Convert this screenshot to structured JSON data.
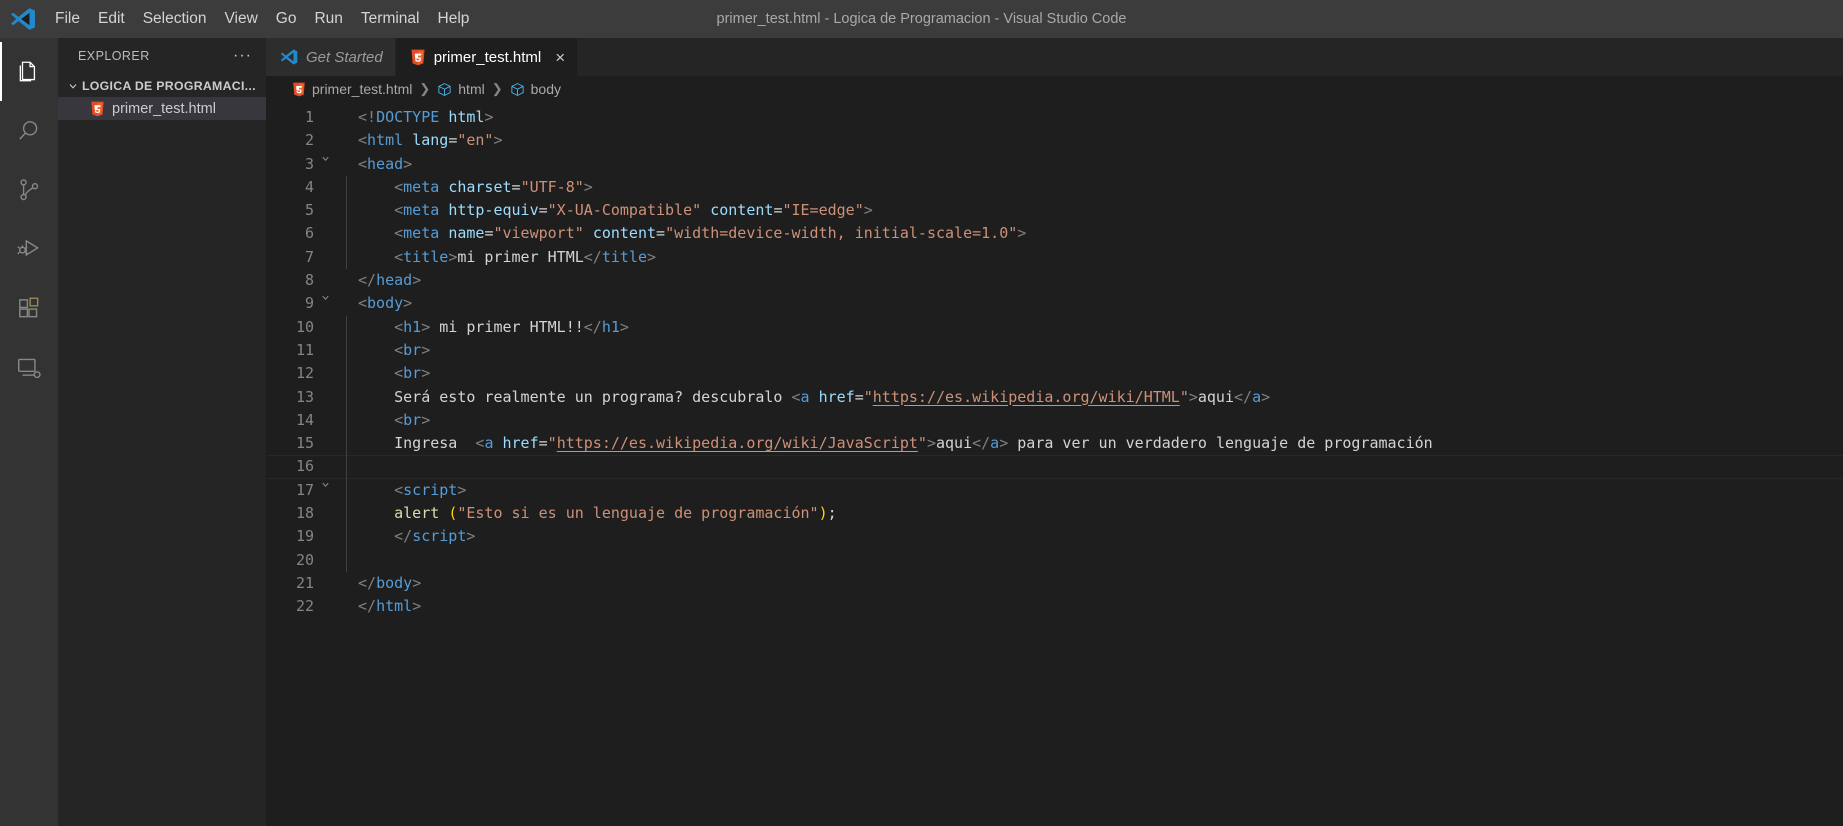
{
  "window": {
    "title": "primer_test.html - Logica de Programacion - Visual Studio Code",
    "logo_icon": "vscode-logo-icon"
  },
  "menubar": {
    "items": [
      {
        "label": "File"
      },
      {
        "label": "Edit"
      },
      {
        "label": "Selection"
      },
      {
        "label": "View"
      },
      {
        "label": "Go"
      },
      {
        "label": "Run"
      },
      {
        "label": "Terminal"
      },
      {
        "label": "Help"
      }
    ]
  },
  "activitybar": {
    "items": [
      {
        "icon": "files-explorer-icon",
        "name": "activitybar-explorer",
        "active": true
      },
      {
        "icon": "search-icon",
        "name": "activitybar-search",
        "active": false
      },
      {
        "icon": "source-control-icon",
        "name": "activitybar-source-control",
        "active": false
      },
      {
        "icon": "run-and-debug-icon",
        "name": "activitybar-run-debug",
        "active": false
      },
      {
        "icon": "extensions-icon",
        "name": "activitybar-extensions",
        "active": false
      },
      {
        "icon": "remote-explorer-icon",
        "name": "activitybar-remote-explorer",
        "active": false
      }
    ]
  },
  "sidebar": {
    "title": "EXPLORER",
    "actions_label": "···",
    "folder": {
      "name": "LOGICA DE PROGRAMACI...",
      "expanded": true,
      "twisty_icon": "chevron-down-icon"
    },
    "files": [
      {
        "name": "primer_test.html",
        "icon": "html5-file-icon",
        "selected": true
      }
    ]
  },
  "tabs": [
    {
      "label": "Get Started",
      "icon": "vscode-logo-icon",
      "active": false,
      "preview": true,
      "closeable": false
    },
    {
      "label": "primer_test.html",
      "icon": "html5-file-icon",
      "active": true,
      "preview": false,
      "closeable": true,
      "close_label": "×"
    }
  ],
  "breadcrumbs": {
    "separator": "❯",
    "items": [
      {
        "label": "primer_test.html",
        "icon": "html5-file-icon"
      },
      {
        "label": "html",
        "icon": "symbol-class-icon"
      },
      {
        "label": "body",
        "icon": "symbol-class-icon"
      }
    ]
  },
  "editor": {
    "colors": {
      "background": "#1e1e1e",
      "tag": "#569cd6",
      "attribute": "#9cdcfe",
      "string": "#ce9178",
      "text": "#d4d4d4",
      "function": "#dcdcaa",
      "paren": "#ffd700",
      "linenumber": "#858585"
    },
    "lines": [
      {
        "n": 1,
        "fold": "",
        "guide": false,
        "cursor": false,
        "tokens": [
          {
            "c": "punct",
            "t": "<!"
          },
          {
            "c": "tag",
            "t": "DOCTYPE"
          },
          {
            "c": "text",
            "t": " "
          },
          {
            "c": "attr",
            "t": "html"
          },
          {
            "c": "punct",
            "t": ">"
          }
        ]
      },
      {
        "n": 2,
        "fold": "",
        "guide": false,
        "cursor": false,
        "tokens": [
          {
            "c": "punct",
            "t": "<"
          },
          {
            "c": "tag",
            "t": "html"
          },
          {
            "c": "text",
            "t": " "
          },
          {
            "c": "attr",
            "t": "lang"
          },
          {
            "c": "eq",
            "t": "="
          },
          {
            "c": "str",
            "t": "\"en\""
          },
          {
            "c": "punct",
            "t": ">"
          }
        ]
      },
      {
        "n": 3,
        "fold": "chevron-down-icon",
        "guide": false,
        "cursor": false,
        "tokens": [
          {
            "c": "punct",
            "t": "<"
          },
          {
            "c": "tag",
            "t": "head"
          },
          {
            "c": "punct",
            "t": ">"
          }
        ]
      },
      {
        "n": 4,
        "fold": "",
        "guide": true,
        "cursor": false,
        "tokens": [
          {
            "c": "text",
            "t": "    "
          },
          {
            "c": "punct",
            "t": "<"
          },
          {
            "c": "tag",
            "t": "meta"
          },
          {
            "c": "text",
            "t": " "
          },
          {
            "c": "attr",
            "t": "charset"
          },
          {
            "c": "eq",
            "t": "="
          },
          {
            "c": "str",
            "t": "\"UTF-8\""
          },
          {
            "c": "punct",
            "t": ">"
          }
        ]
      },
      {
        "n": 5,
        "fold": "",
        "guide": true,
        "cursor": false,
        "tokens": [
          {
            "c": "text",
            "t": "    "
          },
          {
            "c": "punct",
            "t": "<"
          },
          {
            "c": "tag",
            "t": "meta"
          },
          {
            "c": "text",
            "t": " "
          },
          {
            "c": "attr",
            "t": "http-equiv"
          },
          {
            "c": "eq",
            "t": "="
          },
          {
            "c": "str",
            "t": "\"X-UA-Compatible\""
          },
          {
            "c": "text",
            "t": " "
          },
          {
            "c": "attr",
            "t": "content"
          },
          {
            "c": "eq",
            "t": "="
          },
          {
            "c": "str",
            "t": "\"IE=edge\""
          },
          {
            "c": "punct",
            "t": ">"
          }
        ]
      },
      {
        "n": 6,
        "fold": "",
        "guide": true,
        "cursor": false,
        "tokens": [
          {
            "c": "text",
            "t": "    "
          },
          {
            "c": "punct",
            "t": "<"
          },
          {
            "c": "tag",
            "t": "meta"
          },
          {
            "c": "text",
            "t": " "
          },
          {
            "c": "attr",
            "t": "name"
          },
          {
            "c": "eq",
            "t": "="
          },
          {
            "c": "str",
            "t": "\"viewport\""
          },
          {
            "c": "text",
            "t": " "
          },
          {
            "c": "attr",
            "t": "content"
          },
          {
            "c": "eq",
            "t": "="
          },
          {
            "c": "str",
            "t": "\"width=device-width, initial-scale=1.0\""
          },
          {
            "c": "punct",
            "t": ">"
          }
        ]
      },
      {
        "n": 7,
        "fold": "",
        "guide": true,
        "cursor": false,
        "tokens": [
          {
            "c": "text",
            "t": "    "
          },
          {
            "c": "punct",
            "t": "<"
          },
          {
            "c": "tag",
            "t": "title"
          },
          {
            "c": "punct",
            "t": ">"
          },
          {
            "c": "text",
            "t": "mi primer HTML"
          },
          {
            "c": "punct",
            "t": "</"
          },
          {
            "c": "tag",
            "t": "title"
          },
          {
            "c": "punct",
            "t": ">"
          }
        ]
      },
      {
        "n": 8,
        "fold": "",
        "guide": false,
        "cursor": false,
        "tokens": [
          {
            "c": "punct",
            "t": "</"
          },
          {
            "c": "tag",
            "t": "head"
          },
          {
            "c": "punct",
            "t": ">"
          }
        ]
      },
      {
        "n": 9,
        "fold": "chevron-down-icon",
        "guide": false,
        "cursor": false,
        "tokens": [
          {
            "c": "punct",
            "t": "<"
          },
          {
            "c": "tag",
            "t": "body"
          },
          {
            "c": "punct",
            "t": ">"
          }
        ]
      },
      {
        "n": 10,
        "fold": "",
        "guide": true,
        "cursor": false,
        "tokens": [
          {
            "c": "text",
            "t": "    "
          },
          {
            "c": "punct",
            "t": "<"
          },
          {
            "c": "tag",
            "t": "h1"
          },
          {
            "c": "punct",
            "t": ">"
          },
          {
            "c": "text",
            "t": " mi primer HTML!!"
          },
          {
            "c": "punct",
            "t": "</"
          },
          {
            "c": "tag",
            "t": "h1"
          },
          {
            "c": "punct",
            "t": ">"
          }
        ]
      },
      {
        "n": 11,
        "fold": "",
        "guide": true,
        "cursor": false,
        "tokens": [
          {
            "c": "text",
            "t": "    "
          },
          {
            "c": "punct",
            "t": "<"
          },
          {
            "c": "tag",
            "t": "br"
          },
          {
            "c": "punct",
            "t": ">"
          }
        ]
      },
      {
        "n": 12,
        "fold": "",
        "guide": true,
        "cursor": false,
        "tokens": [
          {
            "c": "text",
            "t": "    "
          },
          {
            "c": "punct",
            "t": "<"
          },
          {
            "c": "tag",
            "t": "br"
          },
          {
            "c": "punct",
            "t": ">"
          }
        ]
      },
      {
        "n": 13,
        "fold": "",
        "guide": true,
        "cursor": false,
        "tokens": [
          {
            "c": "text",
            "t": "    Será esto realmente un programa? descubralo "
          },
          {
            "c": "punct",
            "t": "<"
          },
          {
            "c": "tag",
            "t": "a"
          },
          {
            "c": "text",
            "t": " "
          },
          {
            "c": "attr",
            "t": "href"
          },
          {
            "c": "eq",
            "t": "="
          },
          {
            "c": "str",
            "t": "\""
          },
          {
            "c": "link",
            "t": "https://es.wikipedia.org/wiki/HTML"
          },
          {
            "c": "str",
            "t": "\""
          },
          {
            "c": "punct",
            "t": ">"
          },
          {
            "c": "text",
            "t": "aqui"
          },
          {
            "c": "punct",
            "t": "</"
          },
          {
            "c": "tag",
            "t": "a"
          },
          {
            "c": "punct",
            "t": ">"
          }
        ]
      },
      {
        "n": 14,
        "fold": "",
        "guide": true,
        "cursor": false,
        "tokens": [
          {
            "c": "text",
            "t": "    "
          },
          {
            "c": "punct",
            "t": "<"
          },
          {
            "c": "tag",
            "t": "br"
          },
          {
            "c": "punct",
            "t": ">"
          }
        ]
      },
      {
        "n": 15,
        "fold": "",
        "guide": true,
        "cursor": false,
        "tokens": [
          {
            "c": "text",
            "t": "    Ingresa  "
          },
          {
            "c": "punct",
            "t": "<"
          },
          {
            "c": "tag",
            "t": "a"
          },
          {
            "c": "text",
            "t": " "
          },
          {
            "c": "attr",
            "t": "href"
          },
          {
            "c": "eq",
            "t": "="
          },
          {
            "c": "str",
            "t": "\""
          },
          {
            "c": "link",
            "t": "https://es.wikipedia.org/wiki/JavaScript"
          },
          {
            "c": "str",
            "t": "\""
          },
          {
            "c": "punct",
            "t": ">"
          },
          {
            "c": "text",
            "t": "aqui"
          },
          {
            "c": "punct",
            "t": "</"
          },
          {
            "c": "tag",
            "t": "a"
          },
          {
            "c": "punct",
            "t": ">"
          },
          {
            "c": "text",
            "t": " para ver un verdadero lenguaje de programación"
          }
        ]
      },
      {
        "n": 16,
        "fold": "",
        "guide": true,
        "cursor": true,
        "tokens": []
      },
      {
        "n": 17,
        "fold": "chevron-down-icon",
        "guide": true,
        "cursor": false,
        "tokens": [
          {
            "c": "text",
            "t": "    "
          },
          {
            "c": "punct",
            "t": "<"
          },
          {
            "c": "tag",
            "t": "script"
          },
          {
            "c": "punct",
            "t": ">"
          }
        ]
      },
      {
        "n": 18,
        "fold": "",
        "guide": true,
        "cursor": false,
        "tokens": [
          {
            "c": "text",
            "t": "    "
          },
          {
            "c": "fn",
            "t": "alert"
          },
          {
            "c": "text",
            "t": " "
          },
          {
            "c": "paren",
            "t": "("
          },
          {
            "c": "str",
            "t": "\"Esto si es un lenguaje de programación\""
          },
          {
            "c": "paren",
            "t": ")"
          },
          {
            "c": "semi",
            "t": ";"
          }
        ]
      },
      {
        "n": 19,
        "fold": "",
        "guide": true,
        "cursor": false,
        "tokens": [
          {
            "c": "text",
            "t": "    "
          },
          {
            "c": "punct",
            "t": "</"
          },
          {
            "c": "tag",
            "t": "script"
          },
          {
            "c": "punct",
            "t": ">"
          }
        ]
      },
      {
        "n": 20,
        "fold": "",
        "guide": true,
        "cursor": false,
        "tokens": []
      },
      {
        "n": 21,
        "fold": "",
        "guide": false,
        "cursor": false,
        "tokens": [
          {
            "c": "punct",
            "t": "</"
          },
          {
            "c": "tag",
            "t": "body"
          },
          {
            "c": "punct",
            "t": ">"
          }
        ]
      },
      {
        "n": 22,
        "fold": "",
        "guide": false,
        "cursor": false,
        "tokens": [
          {
            "c": "punct",
            "t": "</"
          },
          {
            "c": "tag",
            "t": "html"
          },
          {
            "c": "punct",
            "t": ">"
          }
        ]
      }
    ]
  }
}
